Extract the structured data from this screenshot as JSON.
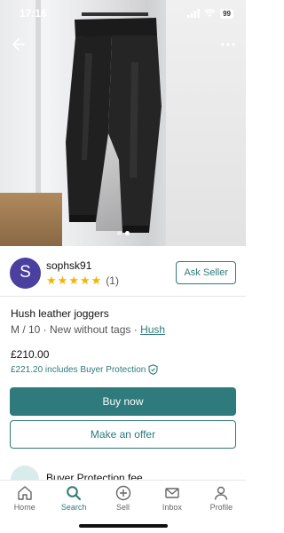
{
  "status": {
    "time": "17:16",
    "battery": "99"
  },
  "gallery": {
    "count": 2,
    "active_index": 1
  },
  "seller": {
    "initial": "S",
    "username": "sophsk91",
    "rating": 5,
    "rating_count": "(1)",
    "ask_label": "Ask Seller"
  },
  "item": {
    "title": "Hush leather joggers",
    "meta": "M / 10 · New without tags · ",
    "brand": "Hush",
    "price": "£210.00",
    "protection_text": "£221.20 includes Buyer Protection"
  },
  "actions": {
    "buy_label": "Buy now",
    "offer_label": "Make an offer"
  },
  "fee": {
    "label": "Buyer Protection fee"
  },
  "tabs": [
    {
      "label": "Home",
      "icon": "home-icon"
    },
    {
      "label": "Search",
      "icon": "search-icon",
      "active": true
    },
    {
      "label": "Sell",
      "icon": "plus-circle-icon"
    },
    {
      "label": "Inbox",
      "icon": "mail-icon"
    },
    {
      "label": "Profile",
      "icon": "person-icon"
    }
  ],
  "colors": {
    "accent": "#2e7a7c",
    "avatar": "#4b3fa0",
    "star": "#f5b400"
  }
}
